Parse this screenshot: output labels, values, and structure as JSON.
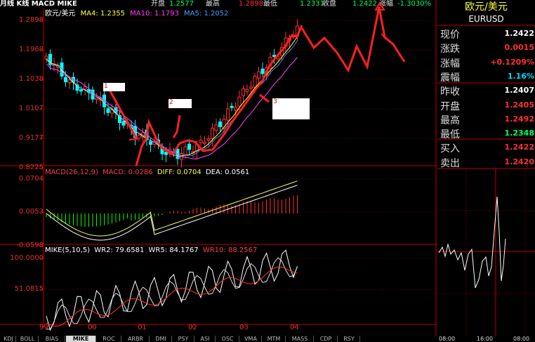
{
  "header": {
    "period_label": "月线 K线 MACD MIKE",
    "quote_items": [
      {
        "label": "开盘",
        "value": "1.2577"
      },
      {
        "label": "最高",
        "value": "1.2898"
      },
      {
        "label": "最低",
        "value": "1.2331"
      },
      {
        "label": "收盘",
        "value": "1.2422"
      },
      {
        "label": "涨幅",
        "value": "-1.3030%"
      }
    ]
  },
  "main_panel": {
    "legend": {
      "symbol": "欧元/美元",
      "ma4": "MA4: 1.2355",
      "ma10": "MA10: 1.1793",
      "ma5": "MA5: 1.2052"
    },
    "y_labels": [
      "1.2898",
      "1.1968",
      "1.1038",
      "1.0107",
      "0.9177",
      "0.8225"
    ],
    "annotations": [
      "1",
      "2",
      "3"
    ]
  },
  "macd_panel": {
    "legend": {
      "title": "MACD(26,12,9)",
      "macd": "MACD: 0.0286",
      "diff": "DIFF: 0.0704",
      "dea": "DEA: 0.0561"
    },
    "y_labels": [
      "0.0704",
      "0.0053",
      "-0.0598"
    ]
  },
  "mike_panel": {
    "legend": {
      "title": "MIKE(5,10,5)",
      "wr2": "WR2: 79.6581",
      "wr5": "WR5: 84.1767",
      "wr10": "WR10: 88.2567"
    },
    "y_labels": [
      "100.0000",
      "51.0815"
    ]
  },
  "x_axis": {
    "labels": [
      "99",
      "00",
      "01",
      "02",
      "03",
      "04"
    ]
  },
  "tabs": [
    "KDJ",
    "BOLL",
    "BIAS",
    "MIKE",
    "ROC",
    "ARBR",
    "DMI",
    "PSY",
    "ASI",
    "OSC",
    "VMA",
    "MTM",
    "MASS",
    "CDP",
    "RSY"
  ],
  "active_tab": "MIKE",
  "side_panel": {
    "title": "欧元/美元",
    "code": "EURUSD",
    "rows": [
      {
        "label": "现价",
        "value": "1.2422",
        "color": "#ffffff"
      },
      {
        "label": "涨跌",
        "value": "0.0015",
        "color": "#ff3030"
      },
      {
        "label": "涨幅",
        "value": "+0.1209%",
        "color": "#ff3030"
      },
      {
        "label": "震幅",
        "value": "1.16%",
        "color": "#00d8ff"
      },
      {
        "label": "昨收",
        "value": "1.2407",
        "color": "#ffffff"
      },
      {
        "label": "开盘",
        "value": "1.2405",
        "color": "#ff3030"
      },
      {
        "label": "最高",
        "value": "1.2492",
        "color": "#ff3030"
      },
      {
        "label": "最低",
        "value": "1.2348",
        "color": "#00ff60"
      },
      {
        "label": "买入",
        "value": "1.2422",
        "color": "#ff3030"
      },
      {
        "label": "卖出",
        "value": "1.2420",
        "color": "#ff3030"
      }
    ],
    "time_labels": [
      "08:00",
      "16:00",
      "08:00"
    ]
  }
}
